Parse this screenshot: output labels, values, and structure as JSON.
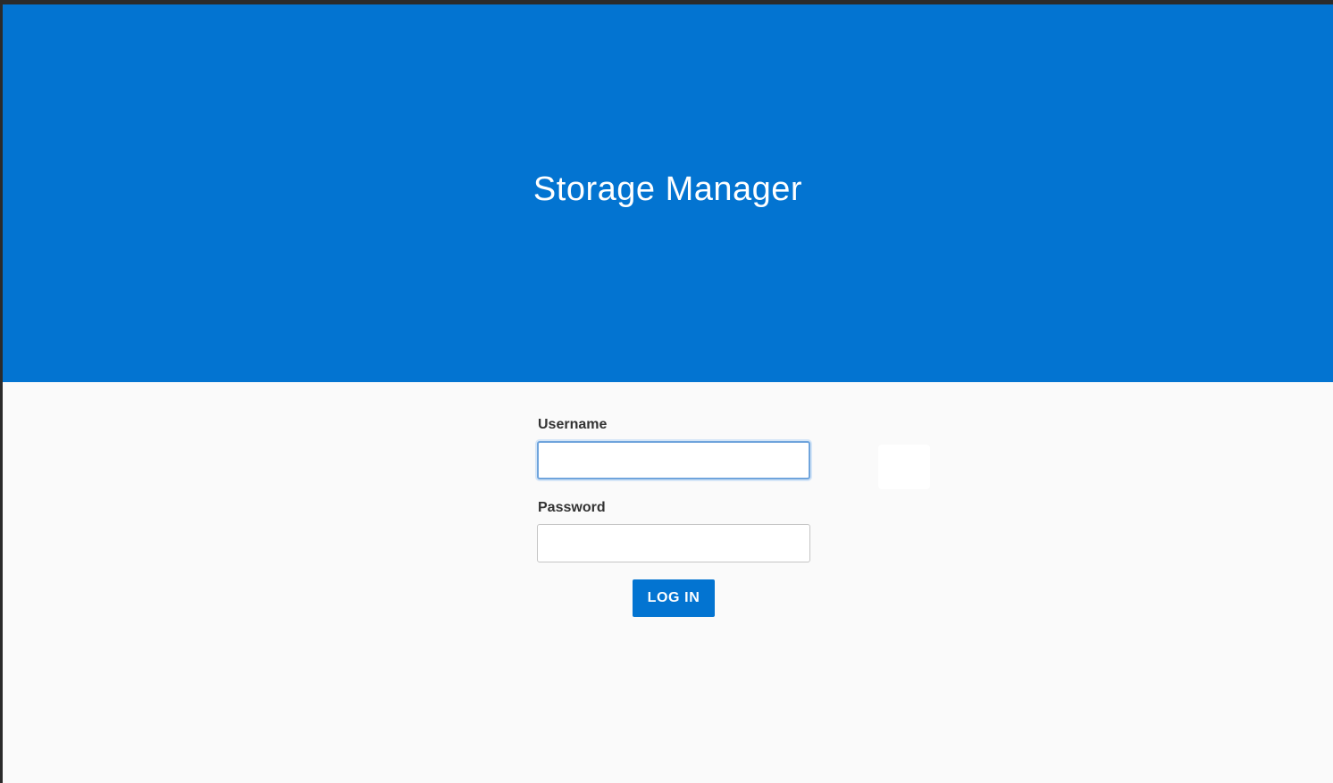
{
  "app": {
    "title": "Storage Manager"
  },
  "login_form": {
    "username_label": "Username",
    "username_value": "",
    "password_label": "Password",
    "password_value": "",
    "submit_label": "LOG IN"
  },
  "colors": {
    "brand_blue": "#0374d1",
    "page_background": "#fafafa",
    "focus_ring": "#6fa4dc"
  }
}
